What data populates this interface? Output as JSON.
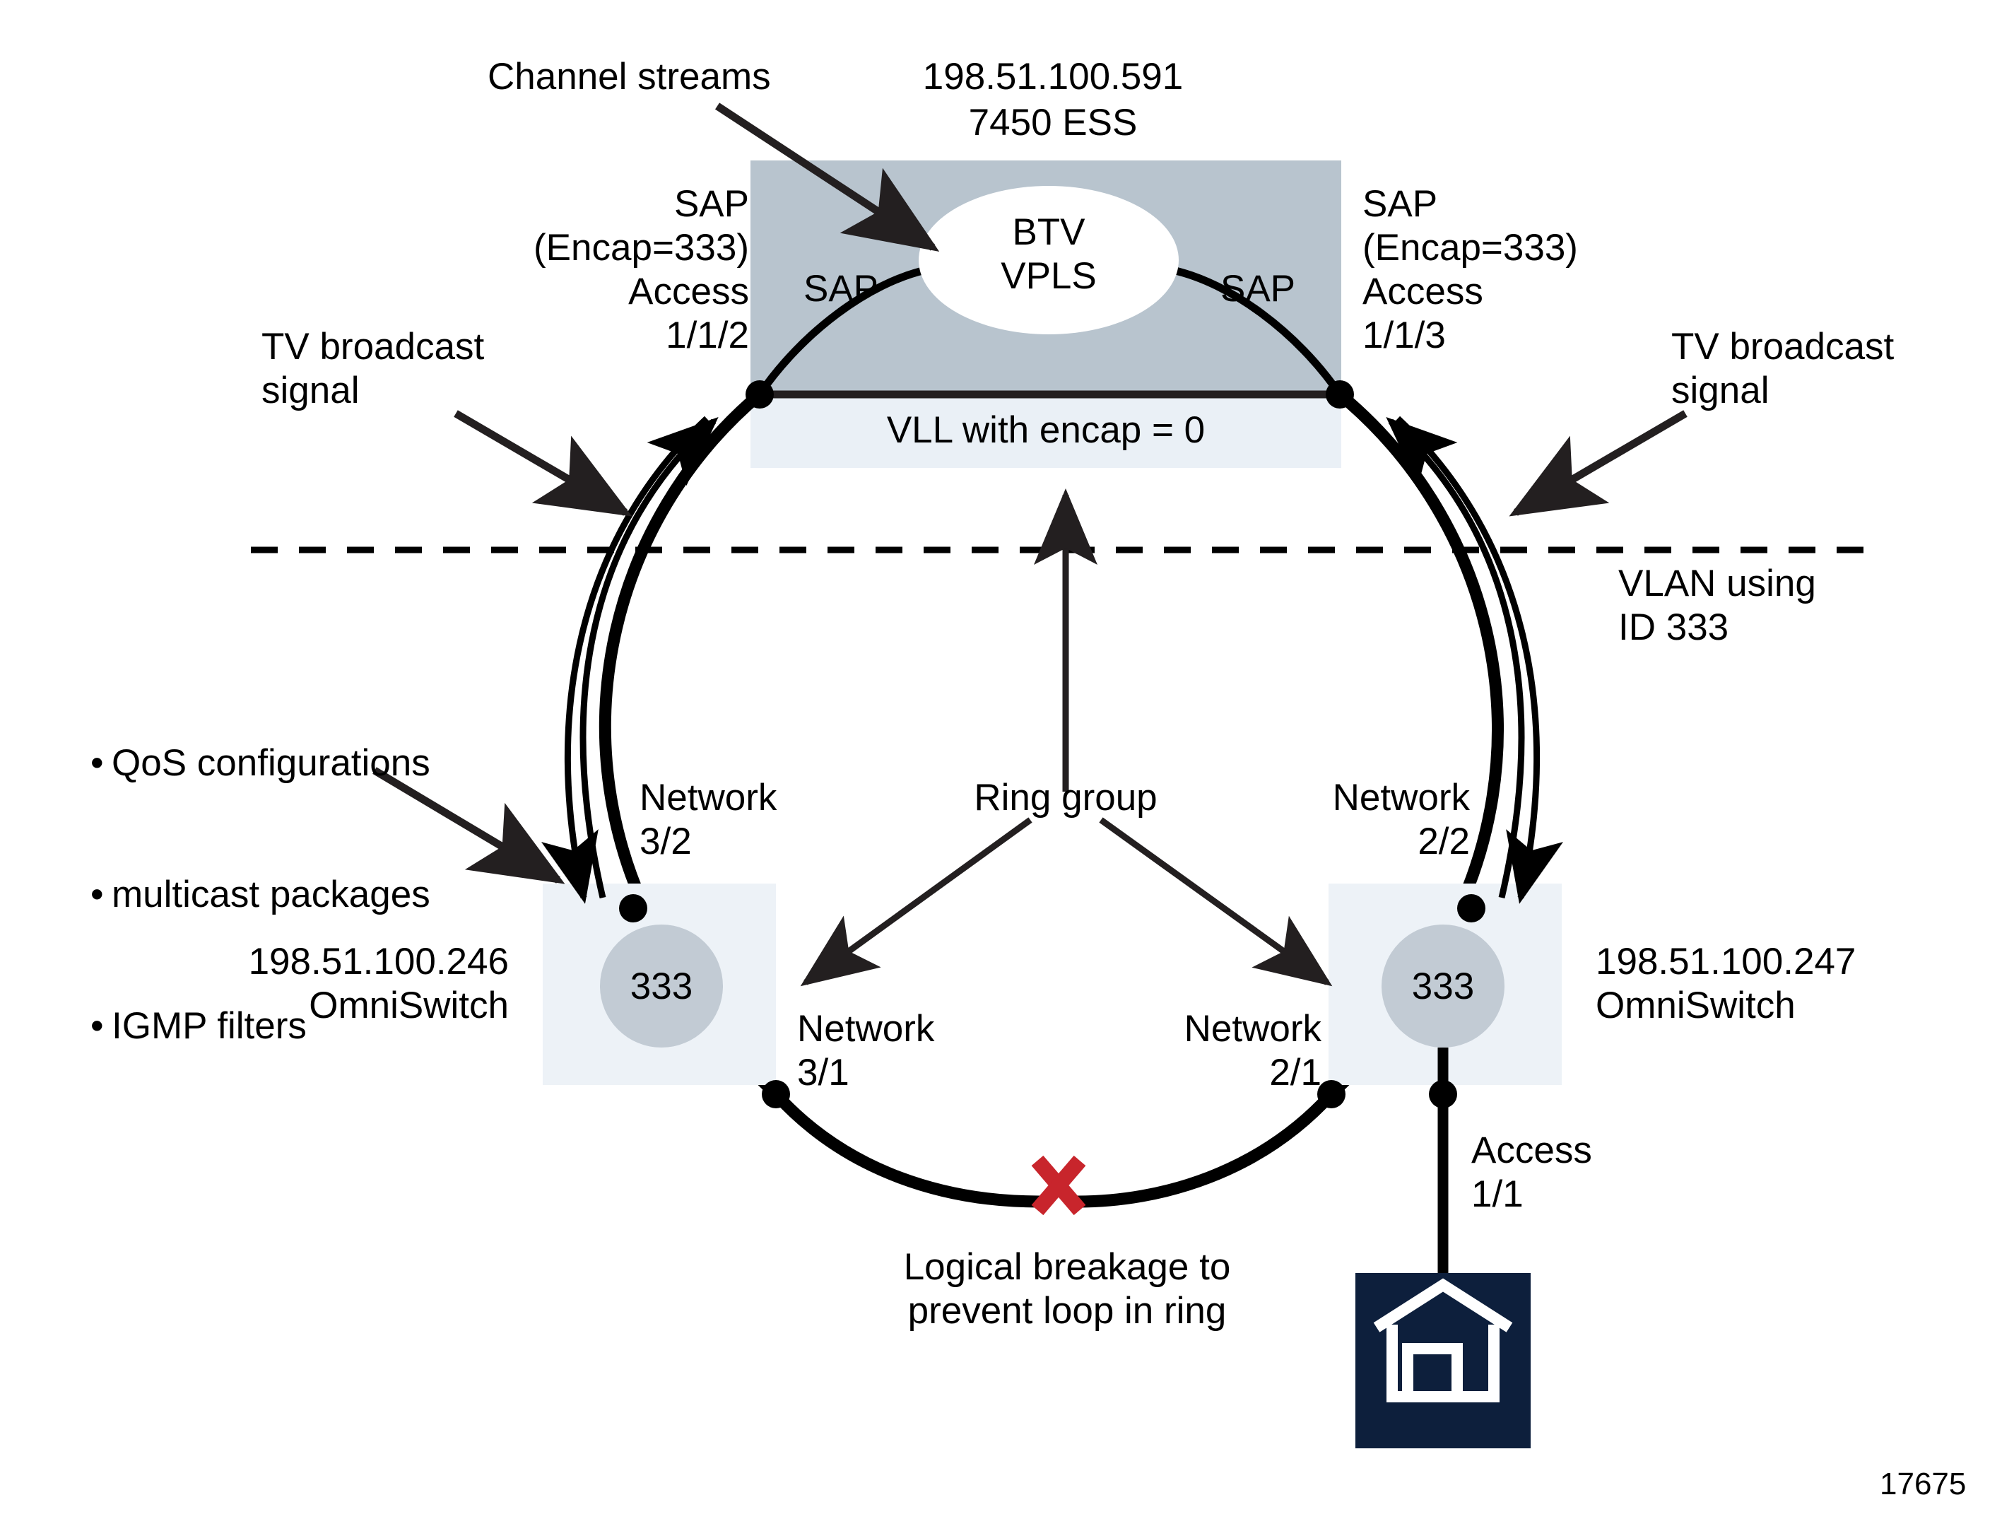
{
  "figure": {
    "number": "17675",
    "colors": {
      "vpls_box": "#b8c4ce",
      "vll_box": "#eaf0f6",
      "switch_box": "#edf2f7",
      "vlan_circle": "#c2cbd4",
      "house_box": "#0d1f3c",
      "break_x": "#c8252c",
      "line": "#000000"
    }
  },
  "labels": {
    "channel_streams": "Channel streams",
    "ess_ip": "198.51.100.591",
    "ess_model": "7450 ESS",
    "sap_left_line1": "SAP",
    "sap_left_line2": "(Encap=333)",
    "sap_left_line3": "Access",
    "sap_left_line4": "1/1/2",
    "sap_right_line1": "SAP",
    "sap_right_line2": "(Encap=333)",
    "sap_right_line3": "Access",
    "sap_right_line4": "1/1/3",
    "sap_inner_left": "SAP",
    "sap_inner_right": "SAP",
    "btv_line1": "BTV",
    "btv_line2": "VPLS",
    "vll": "VLL with encap = 0",
    "tv_broadcast_left_line1": "TV broadcast",
    "tv_broadcast_left_line2": "signal",
    "tv_broadcast_right_line1": "TV broadcast",
    "tv_broadcast_right_line2": "signal",
    "vlan_line1": "VLAN using",
    "vlan_line2": "ID 333",
    "bullet_1": "QoS configurations",
    "bullet_2": "multicast packages",
    "bullet_3": "IGMP filters",
    "network_32_line1": "Network",
    "network_32_line2": "3/2",
    "network_31_line1": "Network",
    "network_31_line2": "3/1",
    "network_22_line1": "Network",
    "network_22_line2": "2/2",
    "network_21_line1": "Network",
    "network_21_line2": "2/1",
    "ring_group": "Ring group",
    "switch_left_ip": "198.51.100.246",
    "switch_left_model": "OmniSwitch",
    "switch_right_ip": "198.51.100.247",
    "switch_right_model": "OmniSwitch",
    "vlan_id_left": "333",
    "vlan_id_right": "333",
    "access_11_line1": "Access",
    "access_11_line2": "1/1",
    "breakage_line1": "Logical breakage to",
    "breakage_line2": "prevent loop in ring"
  }
}
